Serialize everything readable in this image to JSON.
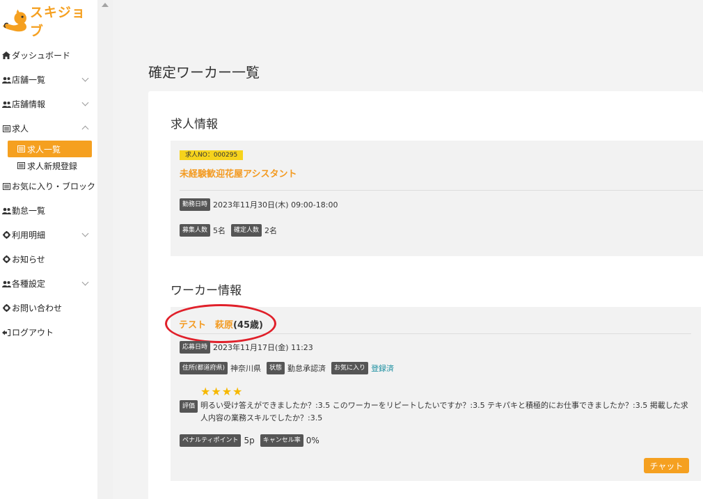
{
  "app": {
    "logo_text": "スキジョブ"
  },
  "sidebar": {
    "items": [
      {
        "label": "ダッシュボード",
        "icon": "home-icon"
      },
      {
        "label": "店舗一覧",
        "icon": "users-icon",
        "expandable": true
      },
      {
        "label": "店舗情報",
        "icon": "users-icon",
        "expandable": true
      },
      {
        "label": "求人",
        "icon": "list-icon",
        "expanded": true,
        "children": [
          {
            "label": "求人一覧",
            "icon": "list-icon",
            "active": true
          },
          {
            "label": "求人新規登録",
            "icon": "list-icon"
          }
        ]
      },
      {
        "label": "お気に入り・ブロック",
        "icon": "list-icon"
      },
      {
        "label": "勤怠一覧",
        "icon": "users-icon"
      },
      {
        "label": "利用明細",
        "icon": "gear-icon",
        "expandable": true
      },
      {
        "label": "お知らせ",
        "icon": "gear-icon"
      },
      {
        "label": "各種設定",
        "icon": "users-icon",
        "expandable": true
      },
      {
        "label": "お問い合わせ",
        "icon": "gear-icon"
      },
      {
        "label": "ログアウト",
        "icon": "logout-icon"
      }
    ]
  },
  "page": {
    "title": "確定ワーカー一覧"
  },
  "job": {
    "section_title": "求人情報",
    "number_badge": "求人NO：000295",
    "title": "未経験歓迎花屋アシスタント",
    "work_date_label": "勤務日時",
    "work_date": "2023年11月30日(木) 09:00-18:00",
    "recruit_label": "募集人数",
    "recruit_value": "5名",
    "confirmed_label": "確定人数",
    "confirmed_value": "2名"
  },
  "worker": {
    "section_title": "ワーカー情報",
    "name": "テスト　萩原",
    "age": "(45歳)",
    "applied_label": "応募日時",
    "applied_at": "2023年11月17日(金) 11:23",
    "address_label": "住所(都道府県)",
    "address": "神奈川県",
    "status_label": "状態",
    "status": "勤怠承認済",
    "favorite_label": "お気に入り",
    "favorite_value": "登録済",
    "rating_label": "評価",
    "rating_stars": 4,
    "review_text": "明るい受け答えができましたか？:3.5 このワーカーをリピートしたいですか？:3.5 テキパキと積極的にお仕事できましたか？:3.5 掲載した求人内容の業務スキルでしたか？:3.5",
    "penalty_label": "ペナルティポイント",
    "penalty_value": "5p",
    "cancel_label": "キャンセル率",
    "cancel_value": "0%",
    "chat_button": "チャット"
  },
  "colors": {
    "accent": "#f5a020",
    "highlight_ellipse": "#e0202a",
    "badge": "#f6d31c",
    "link": "#1a8fa0"
  }
}
